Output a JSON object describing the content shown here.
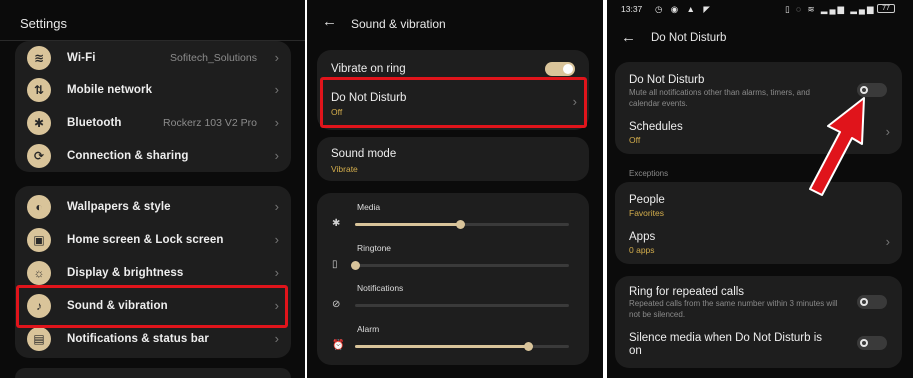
{
  "panel1": {
    "header": "Settings",
    "group1": [
      {
        "label": "Wi-Fi",
        "value": "Sofitech_Solutions",
        "icon": "wifi-icon",
        "glyph": "≋"
      },
      {
        "label": "Mobile network",
        "value": "",
        "icon": "mobile-network-icon",
        "glyph": "⇅"
      },
      {
        "label": "Bluetooth",
        "value": "Rockerz 103 V2 Pro",
        "icon": "bluetooth-icon",
        "glyph": "✱"
      },
      {
        "label": "Connection & sharing",
        "value": "",
        "icon": "connection-icon",
        "glyph": "⟳"
      }
    ],
    "group2": [
      {
        "label": "Wallpapers & style",
        "value": "",
        "icon": "palette-icon",
        "glyph": "◐"
      },
      {
        "label": "Home screen & Lock screen",
        "value": "",
        "icon": "home-screen-icon",
        "glyph": "▣"
      },
      {
        "label": "Display & brightness",
        "value": "",
        "icon": "brightness-icon",
        "glyph": "☼"
      },
      {
        "label": "Sound & vibration",
        "value": "",
        "icon": "bell-icon",
        "glyph": "♪"
      },
      {
        "label": "Notifications & status bar",
        "value": "",
        "icon": "notifications-icon",
        "glyph": "▤"
      }
    ],
    "chevron": "›"
  },
  "panel2": {
    "title": "Sound & vibration",
    "back": "←",
    "vibrate_on_ring": "Vibrate on ring",
    "dnd_label": "Do Not Disturb",
    "dnd_value": "Off",
    "sound_mode_label": "Sound mode",
    "sound_mode_value": "Vibrate",
    "sliders": [
      {
        "label": "Media",
        "glyph": "✱",
        "icon": "bluetooth-icon",
        "level": 0.49
      },
      {
        "label": "Ringtone",
        "glyph": "▯",
        "icon": "vibrate-icon",
        "level": 0.0
      },
      {
        "label": "Notifications",
        "glyph": "⊘",
        "icon": "notifications-muted-icon",
        "level": 0.0
      },
      {
        "label": "Alarm",
        "glyph": "⏰",
        "icon": "alarm-icon",
        "level": 0.81
      }
    ],
    "chevron": "›"
  },
  "panel3": {
    "status_time": "13:37",
    "status_battery": "77",
    "title": "Do Not Disturb",
    "back": "←",
    "dnd_label": "Do Not Disturb",
    "dnd_desc": "Mute all notifications other than alarms, timers, and calendar events.",
    "schedules_label": "Schedules",
    "schedules_value": "Off",
    "exceptions_header": "Exceptions",
    "people_label": "People",
    "people_value": "Favorites",
    "apps_label": "Apps",
    "apps_value": "0 apps",
    "repeat_label": "Ring for repeated calls",
    "repeat_desc": "Repeated calls from the same number within 3 minutes will not be silenced.",
    "silence_label": "Silence media when Do Not Disturb is on",
    "chevron": "›"
  },
  "colors": {
    "accent": "#d9c49a",
    "highlight": "#e0141b",
    "background": "#0b0b0b",
    "card": "#1e1e1e"
  }
}
